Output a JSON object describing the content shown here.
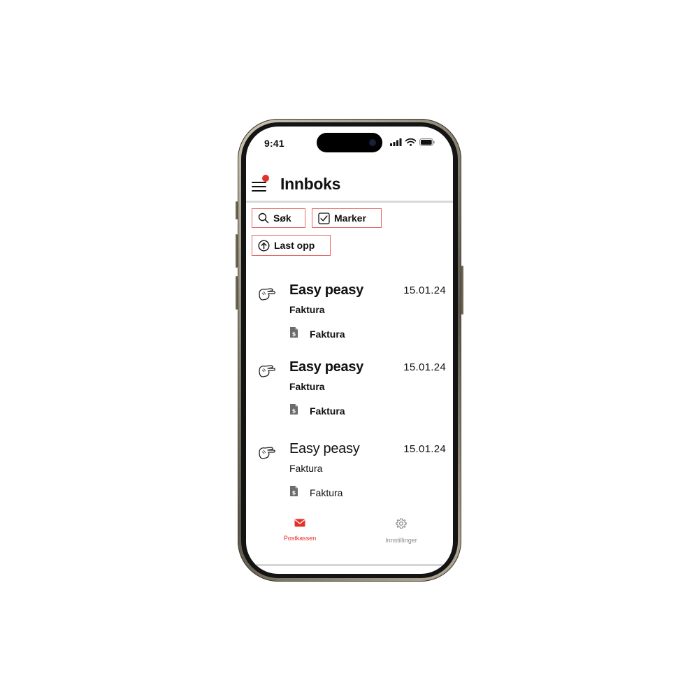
{
  "status_bar": {
    "time": "9:41"
  },
  "header": {
    "title": "Innboks"
  },
  "actions": {
    "search_label": "Søk",
    "select_label": "Marker",
    "upload_label": "Last opp"
  },
  "messages": [
    {
      "sender": "Easy peasy",
      "date": "15.01.24",
      "subject": "Faktura",
      "attachment": "Faktura",
      "unread": true
    },
    {
      "sender": "Easy peasy",
      "date": "15.01.24",
      "subject": "Faktura",
      "attachment": "Faktura",
      "unread": true
    },
    {
      "sender": "Easy peasy",
      "date": "15.01.24",
      "subject": "Faktura",
      "attachment": "Faktura",
      "unread": false
    }
  ],
  "tabbar": {
    "mailbox_label": "Postkassen",
    "settings_label": "Innstillinger"
  },
  "icons": {
    "menu": "hamburger-icon",
    "search": "search-icon",
    "select": "checkbox-icon",
    "upload": "upload-arrow-icon",
    "sender_logo": "hand-logo-icon",
    "attachment": "document-dollar-icon",
    "mailbox": "envelope-icon",
    "settings": "gear-icon"
  },
  "colors": {
    "accent": "#e4312b",
    "button_border": "#e26b66",
    "inactive_tab": "#8a8a8a"
  }
}
